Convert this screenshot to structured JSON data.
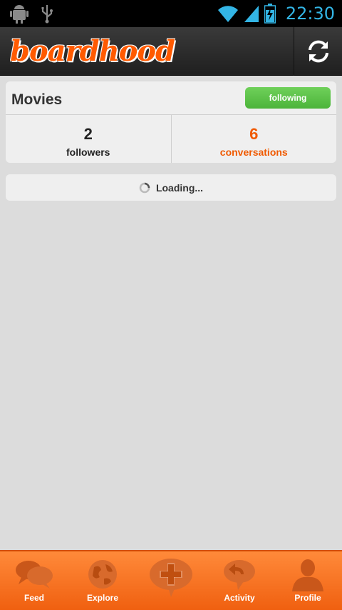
{
  "status_bar": {
    "time": "22:30"
  },
  "app": {
    "brand": "boardhood"
  },
  "topic": {
    "title": "Movies",
    "follow_label": "following",
    "stats": [
      {
        "value": "2",
        "label": "followers"
      },
      {
        "value": "6",
        "label": "conversations"
      }
    ]
  },
  "loading": {
    "label": "Loading..."
  },
  "nav": {
    "items": [
      {
        "label": "Feed",
        "icon": "feed-icon"
      },
      {
        "label": "Explore",
        "icon": "globe-icon"
      },
      {
        "label": "",
        "icon": "add-icon"
      },
      {
        "label": "Activity",
        "icon": "activity-icon"
      },
      {
        "label": "Profile",
        "icon": "profile-icon"
      }
    ]
  },
  "colors": {
    "accent": "#f05a00",
    "following_green": "#4cb43a",
    "clock_blue": "#33b5e5"
  }
}
